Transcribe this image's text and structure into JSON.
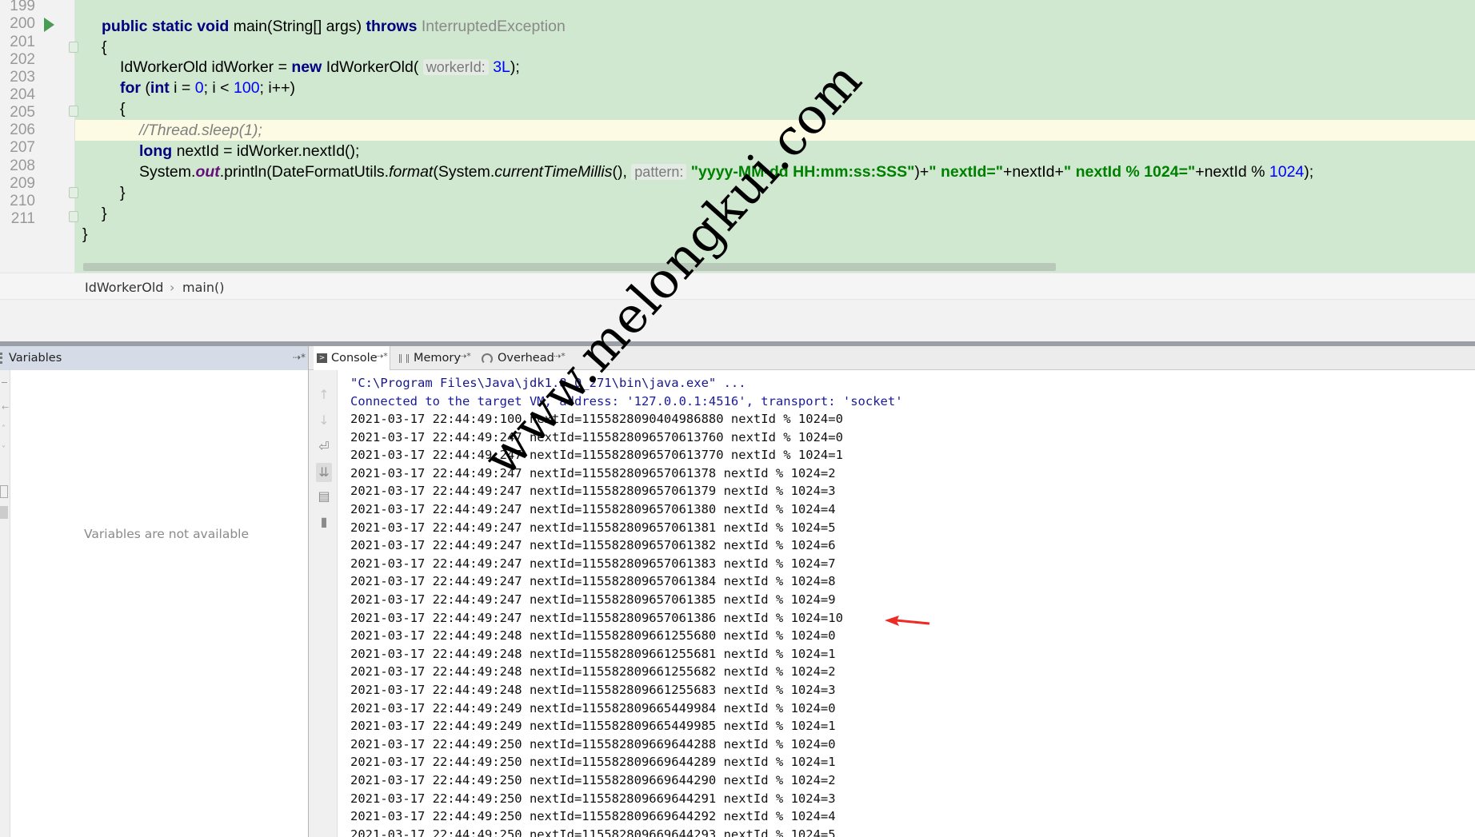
{
  "editor": {
    "line_numbers": [
      "199",
      "200",
      "201",
      "202",
      "203",
      "204",
      "205",
      "206",
      "207",
      "208",
      "209",
      "210",
      "211"
    ],
    "code": {
      "l200": {
        "kw1": "public static void ",
        "plain1": "main(String[] args) ",
        "kw2": "throws ",
        "exc": "InterruptedException"
      },
      "l201": "{",
      "l202": {
        "p1": "IdWorkerOld idWorker = ",
        "kw": "new ",
        "p2": "IdWorkerOld( ",
        "hint": "workerId:",
        "num": "3L",
        "p3": ");"
      },
      "l203": {
        "kw1": "for ",
        "p1": "(",
        "kw2": "int ",
        "p2": "i = ",
        "n1": "0",
        "p3": "; i < ",
        "n2": "100",
        "p4": "; i++)"
      },
      "l204": "{",
      "l205": "//Thread.sleep(1);",
      "l206": {
        "kw": "long ",
        "p": "nextId = idWorker.nextId();"
      },
      "l207": {
        "p1": "System.",
        "fld": "out",
        "p2": ".println(DateFormatUtils.",
        "m1": "format",
        "p3": "(System.",
        "m2": "currentTimeMillis",
        "p4": "(), ",
        "hint": "pattern:",
        "s1": "\"yyyy-MM-dd HH:mm:ss:SSS\"",
        "p5": ")+",
        "s2": "\" nextId=\"",
        "p6": "+nextId+",
        "s3": "\" nextId % 1024=\"",
        "p7": "+nextId % ",
        "n": "1024",
        "p8": ");"
      },
      "l208": "}",
      "l209": "}",
      "l210": "}"
    },
    "breadcrumb": {
      "class": "IdWorkerOld",
      "method": "main()",
      "sep": "›"
    }
  },
  "panels": {
    "variables": {
      "title": "Variables",
      "empty_text": "Variables are not available"
    },
    "tabs": [
      {
        "label": "Console",
        "pin": "⇢*"
      },
      {
        "label": "Memory",
        "pin": "⇢*"
      },
      {
        "label": "Overhead",
        "pin": "⇢*"
      }
    ]
  },
  "console": {
    "header_lines": [
      "\"C:\\Program Files\\Java\\jdk1.8.0_271\\bin\\java.exe\" ...",
      "Connected to the target VM, address: '127.0.0.1:4516', transport: 'socket'"
    ],
    "lines": [
      "2021-03-17 22:44:49:100 nextId=1155828090404986880 nextId % 1024=0",
      "2021-03-17 22:44:49:247 nextId=1155828096570613760 nextId % 1024=0",
      "2021-03-17 22:44:49:247 nextId=1155828096570613770 nextId % 1024=1",
      "2021-03-17 22:44:49:247 nextId=115582809657061378 nextId % 1024=2",
      "2021-03-17 22:44:49:247 nextId=115582809657061379 nextId % 1024=3",
      "2021-03-17 22:44:49:247 nextId=115582809657061380 nextId % 1024=4",
      "2021-03-17 22:44:49:247 nextId=115582809657061381 nextId % 1024=5",
      "2021-03-17 22:44:49:247 nextId=115582809657061382 nextId % 1024=6",
      "2021-03-17 22:44:49:247 nextId=115582809657061383 nextId % 1024=7",
      "2021-03-17 22:44:49:247 nextId=115582809657061384 nextId % 1024=8",
      "2021-03-17 22:44:49:247 nextId=115582809657061385 nextId % 1024=9",
      "2021-03-17 22:44:49:247 nextId=115582809657061386 nextId % 1024=10",
      "2021-03-17 22:44:49:248 nextId=115582809661255680 nextId % 1024=0",
      "2021-03-17 22:44:49:248 nextId=115582809661255681 nextId % 1024=1",
      "2021-03-17 22:44:49:248 nextId=115582809661255682 nextId % 1024=2",
      "2021-03-17 22:44:49:248 nextId=115582809661255683 nextId % 1024=3",
      "2021-03-17 22:44:49:249 nextId=115582809665449984 nextId % 1024=0",
      "2021-03-17 22:44:49:249 nextId=115582809665449985 nextId % 1024=1",
      "2021-03-17 22:44:49:250 nextId=115582809669644288 nextId % 1024=0",
      "2021-03-17 22:44:49:250 nextId=115582809669644289 nextId % 1024=1",
      "2021-03-17 22:44:49:250 nextId=115582809669644290 nextId % 1024=2",
      "2021-03-17 22:44:49:250 nextId=115582809669644291 nextId % 1024=3",
      "2021-03-17 22:44:49:250 nextId=115582809669644292 nextId % 1024=4",
      "2021-03-17 22:44:49:250 nextId=115582809669644293 nextId % 1024=5"
    ]
  },
  "watermark": "www.melongkui.com",
  "colors": {
    "editor_bg": "#cfe8cf",
    "keyword": "#000080",
    "string": "#008000",
    "number": "#0000ff",
    "arrow": "#ee2a24"
  }
}
